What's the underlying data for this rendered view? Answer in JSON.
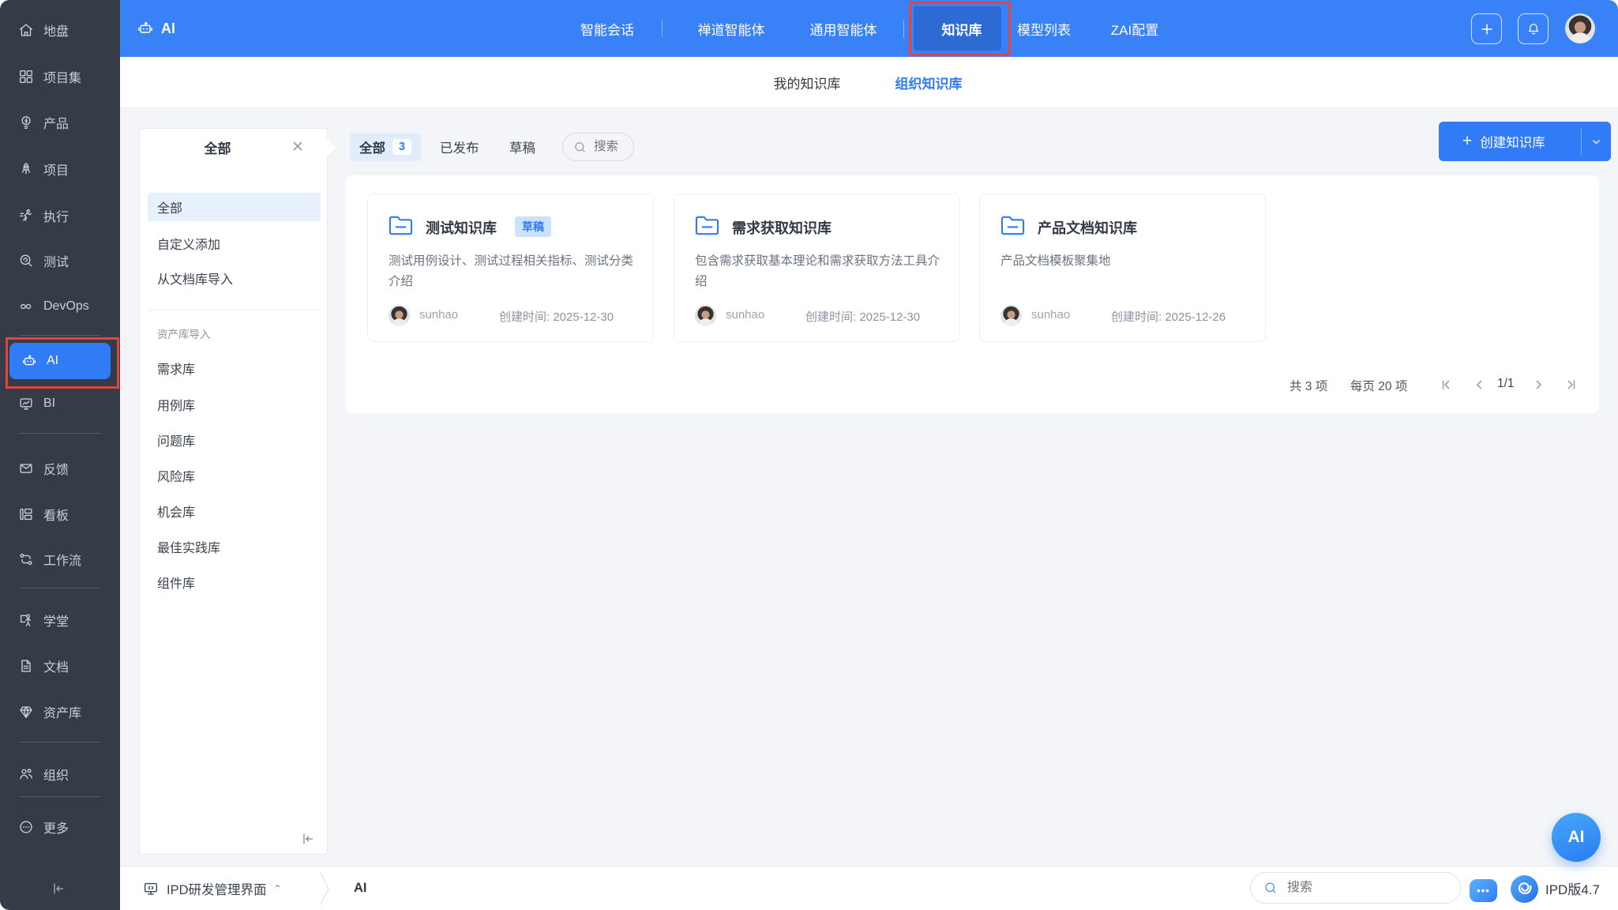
{
  "colors": {
    "accent": "#2f7cf6",
    "topbar_blue": "#3981f7",
    "sidebar_bg": "#353b47",
    "annotation_red": "#e5443d"
  },
  "topbar": {
    "app_label": "AI",
    "nav": [
      {
        "label": "智能会话"
      },
      {
        "label": "禅道智能体"
      },
      {
        "label": "通用智能体"
      },
      {
        "label": "知识库",
        "active": true
      },
      {
        "label": "模型列表"
      },
      {
        "label": "ZAI配置"
      }
    ]
  },
  "sidebar": {
    "items": [
      {
        "label": "地盘"
      },
      {
        "label": "项目集"
      },
      {
        "label": "产品"
      },
      {
        "label": "项目"
      },
      {
        "label": "执行"
      },
      {
        "label": "测试"
      },
      {
        "label": "DevOps"
      },
      {
        "label": "AI",
        "active": true
      },
      {
        "label": "BI"
      },
      {
        "label": "反馈"
      },
      {
        "label": "看板"
      },
      {
        "label": "工作流"
      },
      {
        "label": "学堂"
      },
      {
        "label": "文档"
      },
      {
        "label": "资产库"
      },
      {
        "label": "组织"
      },
      {
        "label": "更多"
      }
    ]
  },
  "subtabs": {
    "mine": "我的知识库",
    "org": "组织知识库"
  },
  "filter": {
    "header": "全部",
    "section_label": "资产库导入",
    "items": [
      {
        "label": "全部",
        "selected": true
      },
      {
        "label": "自定义添加"
      },
      {
        "label": "从文档库导入"
      },
      {
        "label": "需求库"
      },
      {
        "label": "用例库"
      },
      {
        "label": "问题库"
      },
      {
        "label": "风险库"
      },
      {
        "label": "机会库"
      },
      {
        "label": "最佳实践库"
      },
      {
        "label": "组件库"
      }
    ]
  },
  "toolbar": {
    "tab_all": "全部",
    "tab_all_count": "3",
    "tab_published": "已发布",
    "tab_draft": "草稿",
    "search_placeholder": "搜索",
    "create_label": "创建知识库"
  },
  "cards": [
    {
      "title": "测试知识库",
      "badge": "草稿",
      "desc": "测试用例设计、测试过程相关指标、测试分类介绍",
      "owner": "sunhao",
      "created": "创建时间: 2025-12-30"
    },
    {
      "title": "需求获取知识库",
      "desc": "包含需求获取基本理论和需求获取方法工具介绍",
      "owner": "sunhao",
      "created": "创建时间: 2025-12-30"
    },
    {
      "title": "产品文档知识库",
      "desc": "产品文档模板聚集地",
      "owner": "sunhao",
      "created": "创建时间: 2025-12-26"
    }
  ],
  "pagination": {
    "total": "共 3 项",
    "per_page": "每页 20 项",
    "page": "1/1"
  },
  "bottombar": {
    "workspace": "IPD研发管理界面",
    "section": "AI",
    "search_placeholder": "搜索",
    "version": "IPD版4.7"
  },
  "float_button": {
    "label": "AI"
  }
}
